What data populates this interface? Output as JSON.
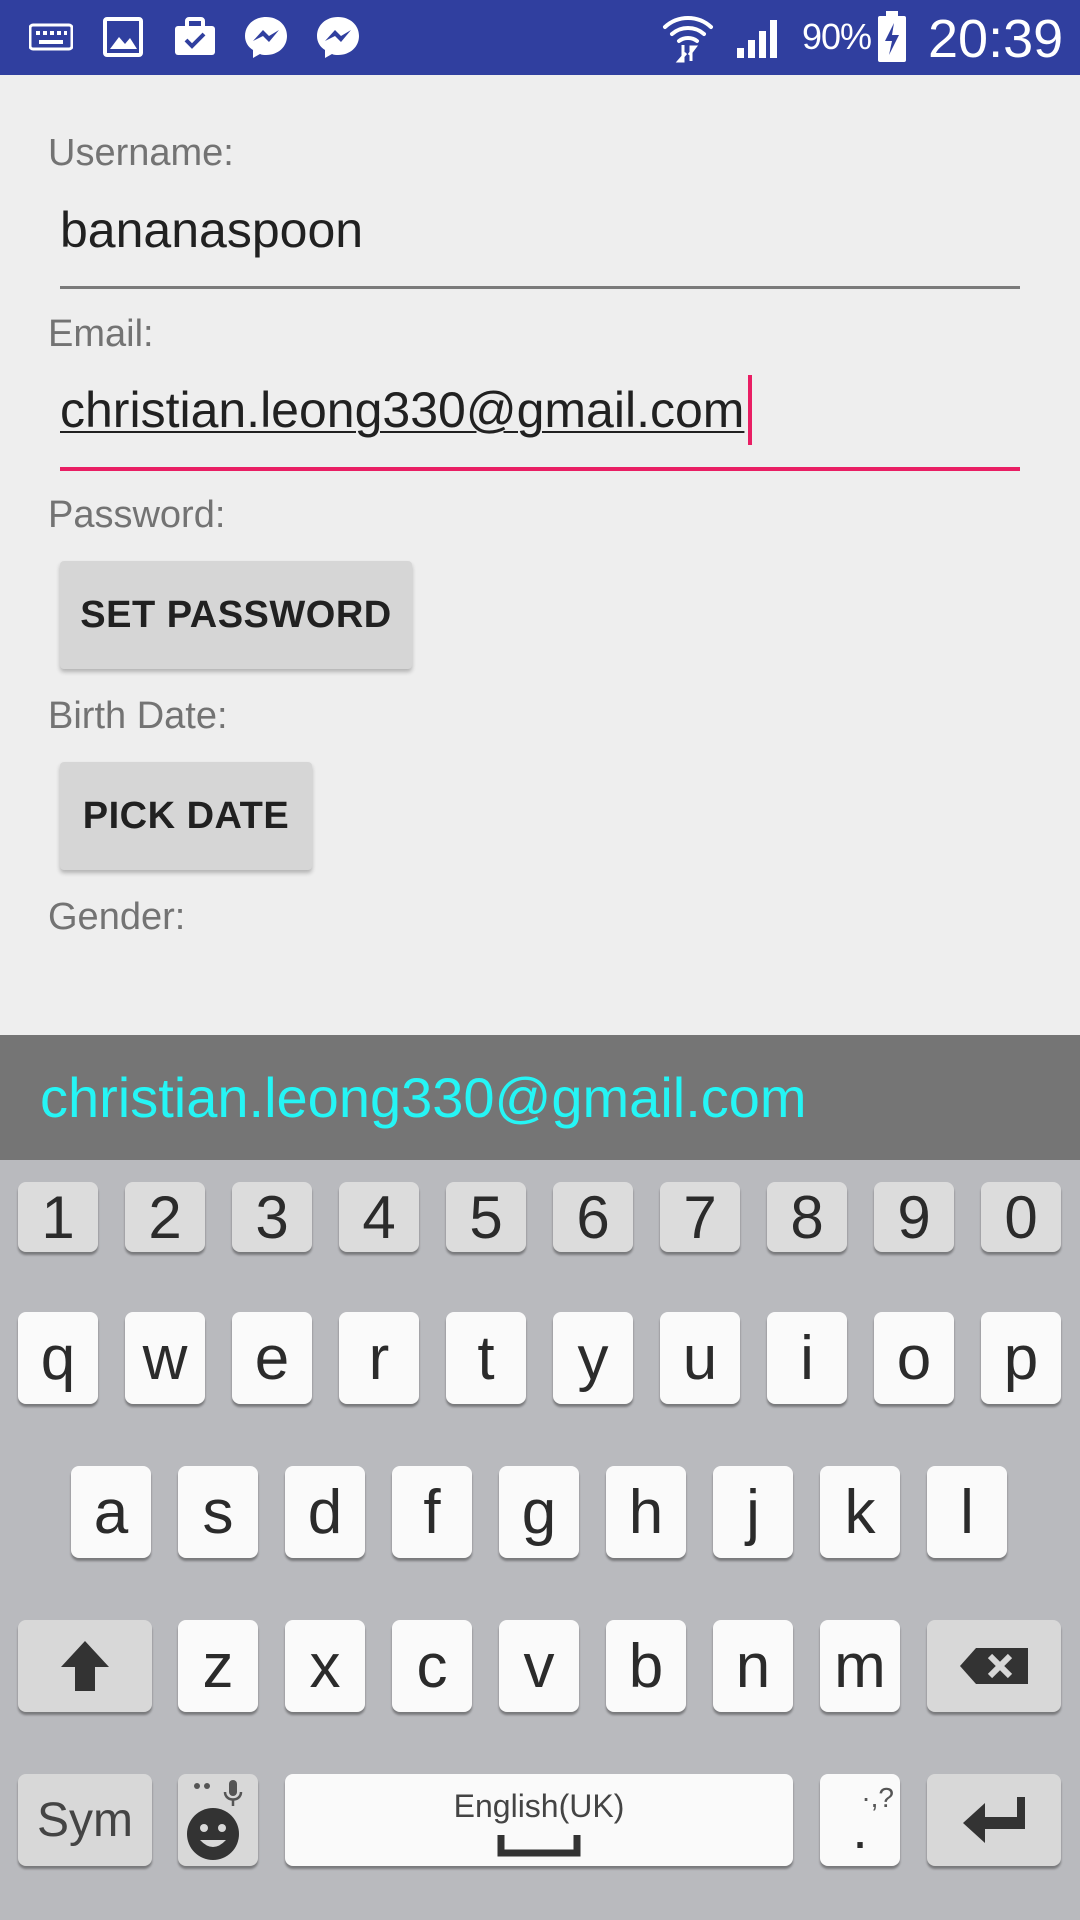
{
  "status_bar": {
    "battery_percent": "90%",
    "time": "20:39",
    "left_icons": [
      "keyboard-icon",
      "image-icon",
      "briefcase-icon",
      "messenger-icon",
      "messenger-icon"
    ],
    "right_icons": [
      "wifi-icon",
      "signal-icon",
      "battery-charging-icon"
    ],
    "background": "#303f9f"
  },
  "form": {
    "username_label": "Username:",
    "username_value": "bananaspoon",
    "email_label": "Email:",
    "email_value": "christian.leong330@gmail.com",
    "password_label": "Password:",
    "set_password_button": "SET PASSWORD",
    "birth_date_label": "Birth Date:",
    "pick_date_button": "PICK DATE",
    "gender_label": "Gender:"
  },
  "suggestion": {
    "text": "christian.leong330@gmail.com",
    "color": "#25f5f5"
  },
  "keyboard": {
    "numbers": [
      "1",
      "2",
      "3",
      "4",
      "5",
      "6",
      "7",
      "8",
      "9",
      "0"
    ],
    "row1": [
      "q",
      "w",
      "e",
      "r",
      "t",
      "y",
      "u",
      "i",
      "o",
      "p"
    ],
    "row2": [
      "a",
      "s",
      "d",
      "f",
      "g",
      "h",
      "j",
      "k",
      "l"
    ],
    "row3": [
      "z",
      "x",
      "c",
      "v",
      "b",
      "n",
      "m"
    ],
    "sym_label": "Sym",
    "space_label": "English(UK)",
    "period_label": ".",
    "period_hint": "·,?",
    "icons": [
      "shift-icon",
      "backspace-icon",
      "emoji-icon",
      "mic-icon",
      "space-icon",
      "enter-icon"
    ]
  },
  "colors": {
    "accent": "#e91e63",
    "background": "#eeeeee",
    "keyboard_bg": "#b9babe"
  }
}
